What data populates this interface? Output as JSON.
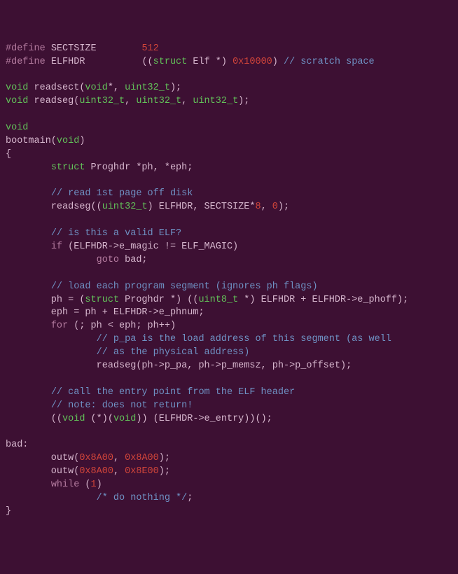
{
  "code": {
    "t": [
      {
        "c": "kw",
        "v": "#define"
      },
      {
        "c": "id",
        "v": " SECTSIZE        "
      },
      {
        "c": "num",
        "v": "512"
      },
      {
        "c": "id",
        "v": "\n"
      },
      {
        "c": "kw",
        "v": "#define"
      },
      {
        "c": "id",
        "v": " ELFHDR          (("
      },
      {
        "c": "type",
        "v": "struct"
      },
      {
        "c": "id",
        "v": " Elf *) "
      },
      {
        "c": "num",
        "v": "0x10000"
      },
      {
        "c": "id",
        "v": ") "
      },
      {
        "c": "cm",
        "v": "// scratch space"
      },
      {
        "c": "id",
        "v": "\n"
      },
      {
        "c": "id",
        "v": "\n"
      },
      {
        "c": "type",
        "v": "void"
      },
      {
        "c": "id",
        "v": " readsect("
      },
      {
        "c": "type",
        "v": "void"
      },
      {
        "c": "id",
        "v": "*, "
      },
      {
        "c": "type",
        "v": "uint32_t"
      },
      {
        "c": "id",
        "v": ");\n"
      },
      {
        "c": "type",
        "v": "void"
      },
      {
        "c": "id",
        "v": " readseg("
      },
      {
        "c": "type",
        "v": "uint32_t"
      },
      {
        "c": "id",
        "v": ", "
      },
      {
        "c": "type",
        "v": "uint32_t"
      },
      {
        "c": "id",
        "v": ", "
      },
      {
        "c": "type",
        "v": "uint32_t"
      },
      {
        "c": "id",
        "v": ");\n"
      },
      {
        "c": "id",
        "v": "\n"
      },
      {
        "c": "type",
        "v": "void"
      },
      {
        "c": "id",
        "v": "\n"
      },
      {
        "c": "id",
        "v": "bootmain("
      },
      {
        "c": "type",
        "v": "void"
      },
      {
        "c": "id",
        "v": ")\n"
      },
      {
        "c": "id",
        "v": "{\n"
      },
      {
        "c": "id",
        "v": "        "
      },
      {
        "c": "type",
        "v": "struct"
      },
      {
        "c": "id",
        "v": " Proghdr *ph, *eph;\n"
      },
      {
        "c": "id",
        "v": "\n"
      },
      {
        "c": "id",
        "v": "        "
      },
      {
        "c": "cm",
        "v": "// read 1st page off disk"
      },
      {
        "c": "id",
        "v": "\n"
      },
      {
        "c": "id",
        "v": "        readseg(("
      },
      {
        "c": "type",
        "v": "uint32_t"
      },
      {
        "c": "id",
        "v": ") ELFHDR, SECTSIZE*"
      },
      {
        "c": "num",
        "v": "8"
      },
      {
        "c": "id",
        "v": ", "
      },
      {
        "c": "num",
        "v": "0"
      },
      {
        "c": "id",
        "v": ");\n"
      },
      {
        "c": "id",
        "v": "\n"
      },
      {
        "c": "id",
        "v": "        "
      },
      {
        "c": "cm",
        "v": "// is this a valid ELF?"
      },
      {
        "c": "id",
        "v": "\n"
      },
      {
        "c": "id",
        "v": "        "
      },
      {
        "c": "kw",
        "v": "if"
      },
      {
        "c": "id",
        "v": " (ELFHDR->e_magic != ELF_MAGIC)\n"
      },
      {
        "c": "id",
        "v": "                "
      },
      {
        "c": "kw",
        "v": "goto"
      },
      {
        "c": "id",
        "v": " bad;\n"
      },
      {
        "c": "id",
        "v": "\n"
      },
      {
        "c": "id",
        "v": "        "
      },
      {
        "c": "cm",
        "v": "// load each program segment (ignores ph flags)"
      },
      {
        "c": "id",
        "v": "\n"
      },
      {
        "c": "id",
        "v": "        ph = ("
      },
      {
        "c": "type",
        "v": "struct"
      },
      {
        "c": "id",
        "v": " Proghdr *) (("
      },
      {
        "c": "type",
        "v": "uint8_t"
      },
      {
        "c": "id",
        "v": " *) ELFHDR + ELFHDR->e_phoff);\n"
      },
      {
        "c": "id",
        "v": "        eph = ph + ELFHDR->e_phnum;\n"
      },
      {
        "c": "id",
        "v": "        "
      },
      {
        "c": "kw",
        "v": "for"
      },
      {
        "c": "id",
        "v": " (; ph < eph; ph++)\n"
      },
      {
        "c": "id",
        "v": "                "
      },
      {
        "c": "cm",
        "v": "// p_pa is the load address of this segment (as well"
      },
      {
        "c": "id",
        "v": "\n"
      },
      {
        "c": "id",
        "v": "                "
      },
      {
        "c": "cm",
        "v": "// as the physical address)"
      },
      {
        "c": "id",
        "v": "\n"
      },
      {
        "c": "id",
        "v": "                readseg(ph->p_pa, ph->p_memsz, ph->p_offset);\n"
      },
      {
        "c": "id",
        "v": "\n"
      },
      {
        "c": "id",
        "v": "        "
      },
      {
        "c": "cm",
        "v": "// call the entry point from the ELF header"
      },
      {
        "c": "id",
        "v": "\n"
      },
      {
        "c": "id",
        "v": "        "
      },
      {
        "c": "cm",
        "v": "// note: does not return!"
      },
      {
        "c": "id",
        "v": "\n"
      },
      {
        "c": "id",
        "v": "        (("
      },
      {
        "c": "type",
        "v": "void"
      },
      {
        "c": "id",
        "v": " (*)("
      },
      {
        "c": "type",
        "v": "void"
      },
      {
        "c": "id",
        "v": ")) (ELFHDR->e_entry))();\n"
      },
      {
        "c": "id",
        "v": "\n"
      },
      {
        "c": "id",
        "v": "bad:\n"
      },
      {
        "c": "id",
        "v": "        outw("
      },
      {
        "c": "num",
        "v": "0x8A00"
      },
      {
        "c": "id",
        "v": ", "
      },
      {
        "c": "num",
        "v": "0x8A00"
      },
      {
        "c": "id",
        "v": ");\n"
      },
      {
        "c": "id",
        "v": "        outw("
      },
      {
        "c": "num",
        "v": "0x8A00"
      },
      {
        "c": "id",
        "v": ", "
      },
      {
        "c": "num",
        "v": "0x8E00"
      },
      {
        "c": "id",
        "v": ");\n"
      },
      {
        "c": "id",
        "v": "        "
      },
      {
        "c": "kw",
        "v": "while"
      },
      {
        "c": "id",
        "v": " ("
      },
      {
        "c": "num",
        "v": "1"
      },
      {
        "c": "id",
        "v": ")\n"
      },
      {
        "c": "id",
        "v": "                "
      },
      {
        "c": "cm",
        "v": "/* do nothing */"
      },
      {
        "c": "id",
        "v": ";\n"
      },
      {
        "c": "id",
        "v": "}"
      }
    ]
  }
}
